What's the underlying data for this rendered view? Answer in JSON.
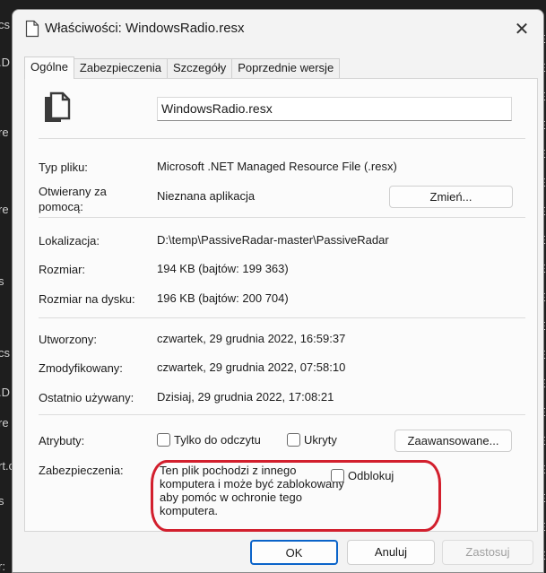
{
  "background": {
    "left_fragments": [
      "cs",
      ".D",
      "re",
      "re",
      "s",
      "cs",
      ".D",
      "re",
      "rt.c",
      "s",
      "r:"
    ],
    "right_fragments": [
      "E",
      "E",
      "E",
      "E",
      "E",
      "E",
      "E",
      "E",
      "E",
      "E",
      "E",
      "E",
      "E",
      "E",
      "E",
      "E",
      "E",
      "E",
      "E"
    ]
  },
  "window": {
    "title": "Właściwości: WindowsRadio.resx",
    "close_glyph": "✕"
  },
  "tabs": [
    {
      "label": "Ogólne",
      "active": true
    },
    {
      "label": "Zabezpieczenia",
      "active": false
    },
    {
      "label": "Szczegóły",
      "active": false
    },
    {
      "label": "Poprzednie wersje",
      "active": false
    }
  ],
  "file": {
    "name": "WindowsRadio.resx",
    "icon": "documents-icon"
  },
  "properties": {
    "type_label": "Typ pliku:",
    "type_value": "Microsoft .NET Managed Resource File (.resx)",
    "opens_with_label": "Otwierany za pomocą:",
    "opens_with_value": "Nieznana aplikacja",
    "change_button": "Zmień...",
    "location_label": "Lokalizacja:",
    "location_value": "D:\\temp\\PassiveRadar-master\\PassiveRadar",
    "size_label": "Rozmiar:",
    "size_value": "194 KB (bajtów: 199 363)",
    "size_on_disk_label": "Rozmiar na dysku:",
    "size_on_disk_value": "196 KB (bajtów: 200 704)",
    "created_label": "Utworzony:",
    "created_value": "czwartek, 29 grudnia 2022, 16:59:37",
    "modified_label": "Zmodyfikowany:",
    "modified_value": "czwartek, 29 grudnia 2022, 07:58:10",
    "accessed_label": "Ostatnio używany:",
    "accessed_value": "Dzisiaj, 29 grudnia 2022, 17:08:21",
    "attributes_label": "Atrybuty:",
    "readonly_label": "Tylko do odczytu",
    "hidden_label": "Ukryty",
    "advanced_button": "Zaawansowane...",
    "security_label": "Zabezpieczenia:",
    "security_text": "Ten plik pochodzi z innego komputera i może być zablokowany aby pomóc w ochronie tego komputera.",
    "unblock_label": "Odblokuj"
  },
  "buttons": {
    "ok": "OK",
    "cancel": "Anuluj",
    "apply": "Zastosuj"
  },
  "colors": {
    "highlight_oval": "#d21f2d",
    "ok_border": "#0a63c9"
  }
}
